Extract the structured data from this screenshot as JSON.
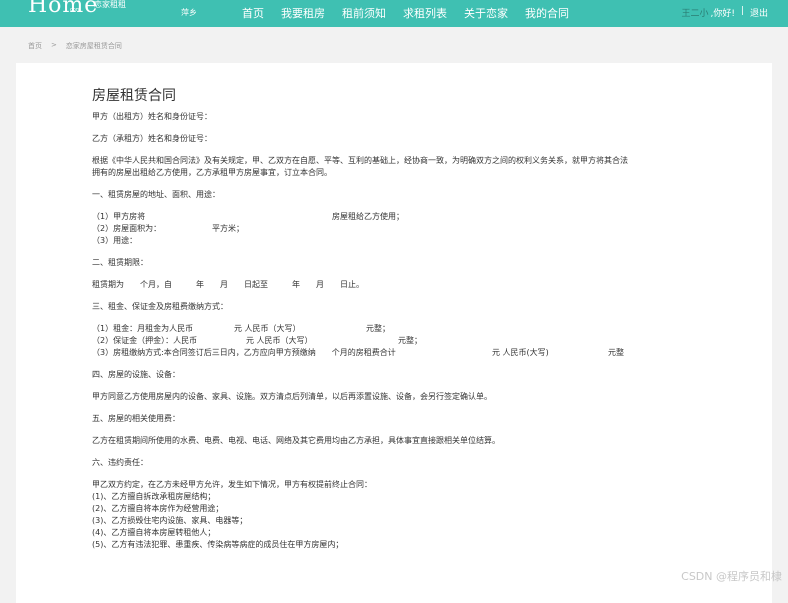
{
  "header": {
    "logo": "Home",
    "logo_sub": "恋家租租",
    "logo_tiny": "com",
    "city": "萍乡",
    "nav": [
      "首页",
      "我要租房",
      "租前须知",
      "求租列表",
      "关于恋家",
      "我的合同"
    ],
    "user_name": "王二小",
    "greeting": ",你好!",
    "separator": "|",
    "logout": "退出"
  },
  "breadcrumb": {
    "home": "首页",
    "separator": ">",
    "current": "恋家房屋租赁合同"
  },
  "contract": {
    "title": "房屋租赁合同",
    "party_a": "甲方（出租方）姓名和身份证号：",
    "party_b": "乙方（承租方）姓名和身份证号：",
    "intro_1": "根据《中华人民共和国合同法》及有关规定，甲、乙双方在自愿、平等、互利的基础上，经协商一致，为明确双方之间的权利义务关系，就甲方将其合法",
    "intro_2": "拥有的房屋出租给乙方使用，乙方承租甲方房屋事宜，订立本合同。",
    "sec1": "一、租赁房屋的地址、面积、用途：",
    "sec1_1a": "（1）甲方房将",
    "sec1_1b": "房屋租给乙方使用；",
    "sec1_2a": "（2）房屋面积为：",
    "sec1_2b": "平方米；",
    "sec1_3": "（3）用途：",
    "sec2": "二、租赁期限：",
    "sec2_line": "租赁期为　　个月，自　　　年　　月　　日起至　　　年　　月　　日止。",
    "sec3": "三、租金、保证金及房租费缴纳方式：",
    "sec3_1a": "（1）租金：月租金为人民币",
    "sec3_1b": "元 人民币（大写）",
    "sec3_1c": "元整；",
    "sec3_2a": "（2）保证金（押金）：人民币",
    "sec3_2b": "元 人民币（大写）",
    "sec3_2c": "元整；",
    "sec3_3a": "（3）房租缴纳方式:本合同签订后三日内，乙方应向甲方预缴纳　　个月的房租费合计",
    "sec3_3b": "元 人民币(大写)",
    "sec3_3c": "元整",
    "sec4": "四、房屋的设施、设备：",
    "sec4_line": "甲方同意乙方使用房屋内的设备、家具、设施。双方清点后列清单，以后再添置设施、设备，会另行签定确认单。",
    "sec5": "五、房屋的相关使用费：",
    "sec5_line": "乙方在租赁期间所使用的水费、电费、电视、电话、网络及其它费用均由乙方承担，具体事宜直接跟相关单位结算。",
    "sec6": "六、违约责任：",
    "sec6_intro": "甲乙双方约定，在乙方未经甲方允许，发生如下情况，甲方有权提前终止合同：",
    "sec6_1": "(1)、乙方擅自拆改承租房屋结构；",
    "sec6_2": "(2)、乙方擅自将本房作为经营用途；",
    "sec6_3": "(3)、乙方损毁住宅内设施、家具、电器等；",
    "sec6_4": "(4)、乙方擅自将本房屋转租他人；",
    "sec6_5": "(5)、乙方有违法犯罪、患重疾、传染病等病症的成员住在甲方房屋内；"
  },
  "watermark": "CSDN @程序员和棣"
}
